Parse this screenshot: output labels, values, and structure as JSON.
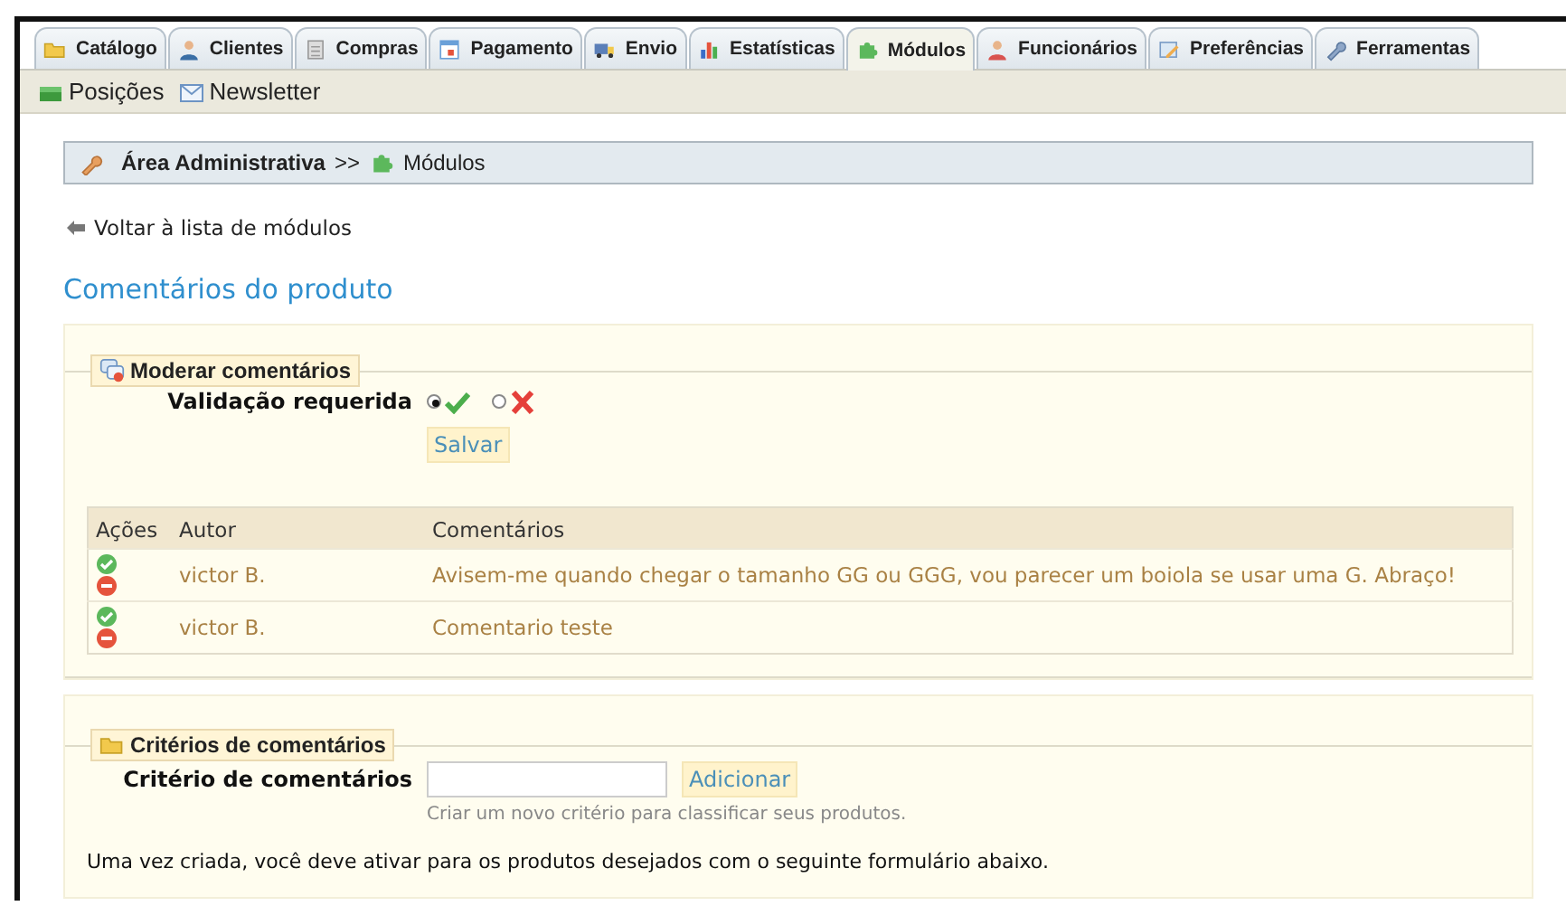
{
  "tabs": [
    {
      "label": "Catálogo",
      "selected": false
    },
    {
      "label": "Clientes",
      "selected": false
    },
    {
      "label": "Compras",
      "selected": false
    },
    {
      "label": "Pagamento",
      "selected": false
    },
    {
      "label": "Envio",
      "selected": false
    },
    {
      "label": "Estatísticas",
      "selected": false
    },
    {
      "label": "Módulos",
      "selected": true
    },
    {
      "label": "Funcionários",
      "selected": false
    },
    {
      "label": "Preferências",
      "selected": false
    },
    {
      "label": "Ferramentas",
      "selected": false
    }
  ],
  "subnav": [
    "Posições",
    "Newsletter"
  ],
  "breadcrumb": {
    "root": "Área Administrativa",
    "separator": ">>",
    "current": "Módulos"
  },
  "back_link": "Voltar à lista de módulos",
  "heading": "Comentários do produto",
  "moderation": {
    "legend": "Moderar comentários",
    "label": "Validação requerida",
    "options": [
      {
        "kind": "approve",
        "selected": true
      },
      {
        "kind": "reject",
        "selected": false
      }
    ],
    "save_button": "Salvar",
    "table": {
      "columns": [
        "Ações",
        "Autor",
        "Comentários"
      ],
      "rows": [
        {
          "author": "victor B.",
          "comment": "Avisem-me quando chegar o tamanho GG ou GGG, vou parecer um boiola se usar uma G. Abraço!"
        },
        {
          "author": "victor B.",
          "comment": "Comentario teste"
        }
      ]
    }
  },
  "criteria": {
    "legend": "Critérios de comentários",
    "label": "Critério de comentários",
    "add_button": "Adicionar",
    "hint": "Criar um novo critério para classificar seus produtos."
  },
  "footer_text": "Uma vez criada, você deve ativar para os produtos desejados com o seguinte formulário abaixo."
}
